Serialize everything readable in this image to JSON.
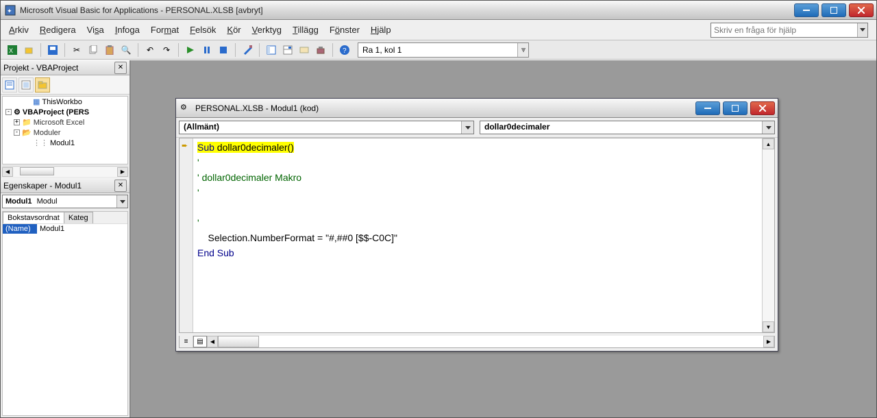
{
  "app": {
    "title": "Microsoft Visual Basic for Applications - PERSONAL.XLSB [avbryt]"
  },
  "menus": {
    "arkiv": "Arkiv",
    "redigera": "Redigera",
    "visa": "Visa",
    "infoga": "Infoga",
    "format": "Format",
    "felsok": "Felsök",
    "kor": "Kör",
    "verktyg": "Verktyg",
    "tillagg": "Tillägg",
    "fonster": "Fönster",
    "hjalp": "Hjälp"
  },
  "help_placeholder": "Skriv en fråga för hjälp",
  "toolbar": {
    "location": "Ra 1, kol 1"
  },
  "project_panel": {
    "title": "Projekt - VBAProject",
    "tree": {
      "thisworkbook": "ThisWorkbo",
      "vbaproject": "VBAProject (PERS",
      "msexcel": "Microsoft Excel",
      "moduler": "Moduler",
      "modul1": "Modul1"
    }
  },
  "props_panel": {
    "title": "Egenskaper - Modul1",
    "object_label": "Modul1",
    "object_type": "Modul",
    "tab1": "Bokstavsordnat",
    "tab2": "Kateg",
    "row_name_key": "(Name)",
    "row_name_val": "Modul1"
  },
  "code_window": {
    "title": "PERSONAL.XLSB - Modul1 (kod)",
    "dd_left": "(Allmänt)",
    "dd_right": "dollar0decimaler",
    "code": {
      "l1_sub": "Sub",
      "l1_name": " dollar0decimaler()",
      "l2": "'",
      "l3": "' dollar0decimaler Makro",
      "l4": "'",
      "l5": "",
      "l6": "'",
      "l7_indent": "    Selection.NumberFormat = ",
      "l7_str": "\"#,##0 [$$-C0C]\"",
      "l8_end": "End Sub"
    }
  }
}
